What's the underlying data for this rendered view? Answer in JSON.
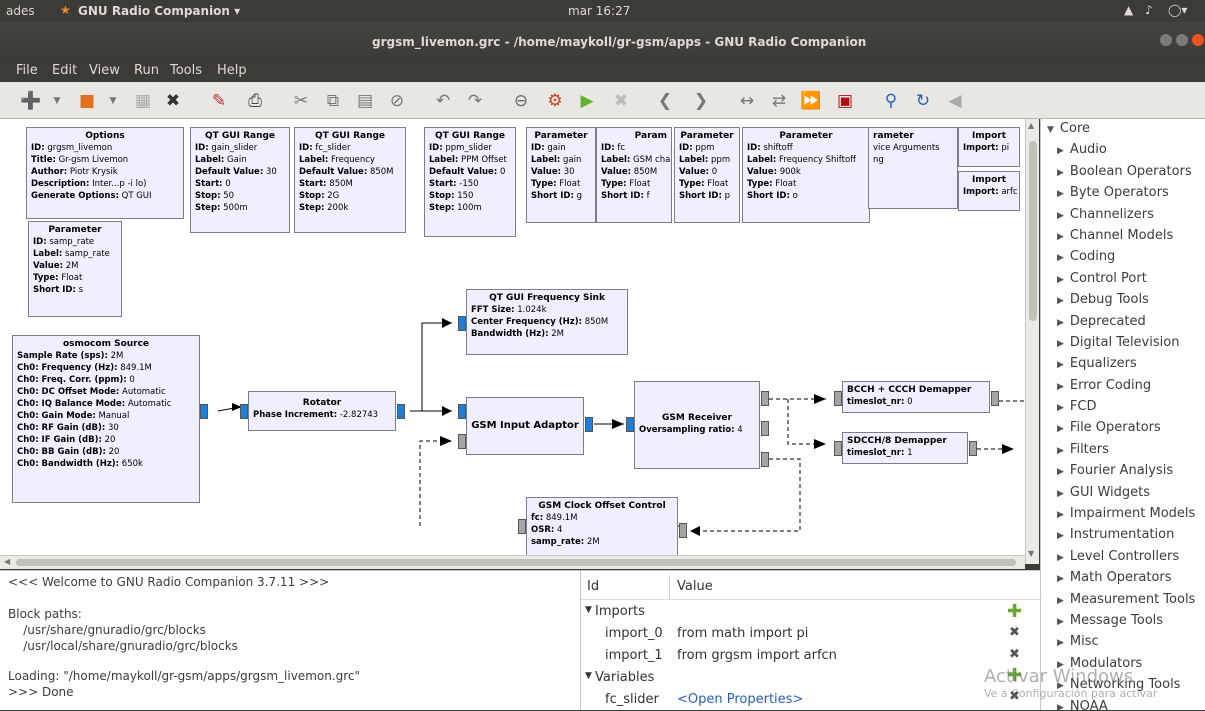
{
  "topbar": {
    "activities": "ades",
    "app_menu": "GNU Radio Companion ▾",
    "clock": "mar 16:27"
  },
  "window": {
    "title": "grgsm_livemon.grc - /home/maykoll/gr-gsm/apps - GNU Radio Companion"
  },
  "menu": {
    "file": "File",
    "edit": "Edit",
    "view": "View",
    "run": "Run",
    "tools": "Tools",
    "help": "Help"
  },
  "blocks": {
    "options": {
      "title": "Options",
      "rows": [
        [
          "ID:",
          "grgsm_livemon"
        ],
        [
          "Title:",
          "Gr-gsm Livemon"
        ],
        [
          "Author:",
          "Piotr Krysik"
        ],
        [
          "Description:",
          "Inter...p -i lo)"
        ],
        [
          "Generate Options:",
          "QT GUI"
        ]
      ]
    },
    "samp_rate": {
      "title": "Parameter",
      "rows": [
        [
          "ID:",
          "samp_rate"
        ],
        [
          "Label:",
          "samp_rate"
        ],
        [
          "Value:",
          "2M"
        ],
        [
          "Type:",
          "Float"
        ],
        [
          "Short ID:",
          "s"
        ]
      ]
    },
    "gain_slider": {
      "title": "QT GUI Range",
      "rows": [
        [
          "ID:",
          "gain_slider"
        ],
        [
          "Label:",
          "Gain"
        ],
        [
          "Default Value:",
          "30"
        ],
        [
          "Start:",
          "0"
        ],
        [
          "Stop:",
          "50"
        ],
        [
          "Step:",
          "500m"
        ]
      ]
    },
    "fc_slider": {
      "title": "QT GUI Range",
      "rows": [
        [
          "ID:",
          "fc_slider"
        ],
        [
          "Label:",
          "Frequency"
        ],
        [
          "Default Value:",
          "850M"
        ],
        [
          "Start:",
          "850M"
        ],
        [
          "Stop:",
          "2G"
        ],
        [
          "Step:",
          "200k"
        ]
      ]
    },
    "ppm_slider": {
      "title": "QT GUI Range",
      "rows": [
        [
          "ID:",
          "ppm_slider"
        ],
        [
          "Label:",
          "PPM Offset"
        ],
        [
          "Default Value:",
          "0"
        ],
        [
          "Start:",
          "-150"
        ],
        [
          "Stop:",
          "150"
        ],
        [
          "Step:",
          "100m"
        ]
      ]
    },
    "gain_param": {
      "title": "Parameter",
      "rows": [
        [
          "ID:",
          "gain"
        ],
        [
          "Label:",
          "gain"
        ],
        [
          "Value:",
          "30"
        ],
        [
          "Type:",
          "Float"
        ],
        [
          "Short ID:",
          "g"
        ]
      ]
    },
    "fc_param": {
      "title": "Param",
      "rows": [
        [
          "ID:",
          "fc"
        ],
        [
          "Label:",
          "GSM cha"
        ],
        [
          "Value:",
          "850M"
        ],
        [
          "Type:",
          "Float"
        ],
        [
          "Short ID:",
          "f"
        ]
      ]
    },
    "ppm_param": {
      "title": "Parameter",
      "rows": [
        [
          "ID:",
          "ppm"
        ],
        [
          "Label:",
          "ppm"
        ],
        [
          "Value:",
          "0"
        ],
        [
          "Type:",
          "Float"
        ],
        [
          "Short ID:",
          "p"
        ]
      ]
    },
    "shiftoff_param": {
      "title": "Parameter",
      "rows": [
        [
          "ID:",
          "shiftoff"
        ],
        [
          "Label:",
          "Frequency Shiftoff"
        ],
        [
          "Value:",
          "900k"
        ],
        [
          "Type:",
          "Float"
        ],
        [
          "Short ID:",
          "o"
        ]
      ]
    },
    "args_param": {
      "title": "rameter",
      "rows": [
        [
          "",
          ""
        ],
        [
          "",
          "vice Arguments"
        ],
        [
          "",
          ""
        ],
        [
          "",
          "ng"
        ],
        [
          "",
          ""
        ]
      ]
    },
    "import_pi": {
      "title": "Import",
      "rows": [
        [
          "Import:",
          "pi"
        ]
      ]
    },
    "import_arfcn": {
      "title": "Import",
      "rows": [
        [
          "Import:",
          "arfc"
        ]
      ]
    },
    "osmocom": {
      "title": "osmocom Source",
      "rows": [
        [
          "Sample Rate (sps):",
          "2M"
        ],
        [
          "Ch0: Frequency (Hz):",
          "849.1M"
        ],
        [
          "Ch0: Freq. Corr. (ppm):",
          "0"
        ],
        [
          "Ch0: DC Offset Mode:",
          "Automatic"
        ],
        [
          "Ch0: IQ Balance Mode:",
          "Automatic"
        ],
        [
          "Ch0: Gain Mode:",
          "Manual"
        ],
        [
          "Ch0: RF Gain (dB):",
          "30"
        ],
        [
          "Ch0: IF Gain (dB):",
          "20"
        ],
        [
          "Ch0: BB Gain (dB):",
          "20"
        ],
        [
          "Ch0: Bandwidth (Hz):",
          "650k"
        ]
      ]
    },
    "rotator": {
      "title": "Rotator",
      "rows": [
        [
          "Phase Increment:",
          "-2.82743"
        ]
      ]
    },
    "freq_sink": {
      "title": "QT GUI Frequency Sink",
      "rows": [
        [
          "FFT Size:",
          "1.024k"
        ],
        [
          "Center Frequency (Hz):",
          "850M"
        ],
        [
          "Bandwidth (Hz):",
          "2M"
        ]
      ]
    },
    "input_adaptor": {
      "title": "GSM Input Adaptor",
      "rows": []
    },
    "receiver": {
      "title": "GSM Receiver",
      "rows": [
        [
          "Oversampling ratio:",
          "4"
        ]
      ]
    },
    "bcch": {
      "title": "BCCH + CCCH Demapper",
      "rows": [
        [
          "timeslot_nr:",
          "0"
        ]
      ]
    },
    "sdcch": {
      "title": "SDCCH/8 Demapper",
      "rows": [
        [
          "timeslot_nr:",
          "1"
        ]
      ]
    },
    "clock_offset": {
      "title": "GSM Clock Offset Control",
      "rows": [
        [
          "fc:",
          "849.1M"
        ],
        [
          "OSR:",
          "4"
        ],
        [
          "samp_rate:",
          "2M"
        ]
      ]
    }
  },
  "tree": {
    "root": "Core",
    "items": [
      "Audio",
      "Boolean Operators",
      "Byte Operators",
      "Channelizers",
      "Channel Models",
      "Coding",
      "Control Port",
      "Debug Tools",
      "Deprecated",
      "Digital Television",
      "Equalizers",
      "Error Coding",
      "FCD",
      "File Operators",
      "Filters",
      "Fourier Analysis",
      "GUI Widgets",
      "Impairment Models",
      "Instrumentation",
      "Level Controllers",
      "Math Operators",
      "Measurement Tools",
      "Message Tools",
      "Misc",
      "Modulators",
      "Networking Tools",
      "NOAA"
    ]
  },
  "console": {
    "lines": [
      "<<< Welcome to GNU Radio Companion 3.7.11 >>>",
      "",
      "Block paths:",
      "    /usr/share/gnuradio/grc/blocks",
      "    /usr/local/share/gnuradio/grc/blocks",
      "",
      "Loading: \"/home/maykoll/gr-gsm/apps/grgsm_livemon.grc\"",
      ">>> Done"
    ]
  },
  "vars": {
    "col_id": "Id",
    "col_value": "Value",
    "imports_label": "Imports",
    "import_0": {
      "id": "import_0",
      "value": "from math import pi"
    },
    "import_1": {
      "id": "import_1",
      "value": "from grgsm import arfcn"
    },
    "variables_label": "Variables",
    "fc_slider": {
      "id": "fc_slider",
      "value": "<Open Properties>"
    }
  },
  "watermark": {
    "line1": "Activar Windows",
    "line2": "Ve a Configuración para activar"
  }
}
